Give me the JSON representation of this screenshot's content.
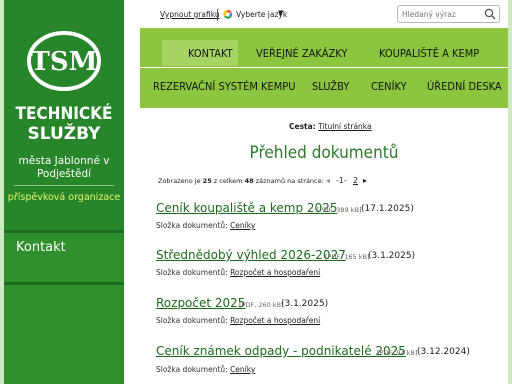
{
  "sidebar": {
    "logo_text": "TSM",
    "title_line1": "TECHNICKÉ",
    "title_line2": "SLUŽBY",
    "subtitle_line1": "města Jablonné v",
    "subtitle_line2": "Podještědí",
    "organization": "příspěvková organizace",
    "menu_kontakt": "Kontakt"
  },
  "topbar": {
    "print_link": "Vypnout grafiku",
    "language_label": "Vyberte jazyk",
    "language_caret": "▼",
    "search_placeholder": "Hledaný výraz"
  },
  "nav": {
    "row1": [
      "KONTAKT",
      "VEŘEJNÉ ZAKÁZKY",
      "KOUPALIŠTĚ A KEMP"
    ],
    "row2": [
      "REZERVAČNÍ SYSTÉM KEMPU",
      "SLUŽBY",
      "CENÍKY",
      "ÚŘEDNÍ DESKA"
    ]
  },
  "breadcrumb": {
    "label": "Cesta:",
    "link": "Titulní stránka"
  },
  "page_title": "Přehled dokumentů",
  "pager": {
    "text_shown": "Zobrazeno je",
    "shown_count": "25",
    "text_from": "z celkem",
    "total_count": "48",
    "text_per_page": "záznamů na stránce:",
    "prev_icon": "◂",
    "current_page": "-1-",
    "next_page": "2",
    "next_icon": "▸"
  },
  "documents": [
    {
      "title": "Ceník koupaliště a kemp 2025",
      "meta": "[PDF, 389 kB]",
      "date": "(17.1.2025)",
      "folder_label": "Složka dokumentů:",
      "folder": "Ceníky"
    },
    {
      "title": "Střednědobý výhled 2026-2027",
      "meta": "[PDF, 165 kB]",
      "date": "(3.1.2025)",
      "folder_label": "Složka dokumentů:",
      "folder": "Rozpočet a hospodaření"
    },
    {
      "title": "Rozpočet 2025",
      "meta": "[PDF, 260 kB]",
      "date": "(3.1.2025)",
      "folder_label": "Složka dokumentů:",
      "folder": "Rozpočet a hospodaření"
    },
    {
      "title": "Ceník známek odpady - podnikatelé 2025",
      "meta": "[PDF, 94 kB]",
      "date": "(3.12.2024)",
      "folder_label": "Složka dokumentů:",
      "folder": "Ceníky"
    }
  ],
  "colors": {
    "sidebar_green": "#2f8f2c",
    "nav_green": "#8cc63f",
    "title_green": "#2b7a2b",
    "org_yellow": "#e6f56a"
  }
}
